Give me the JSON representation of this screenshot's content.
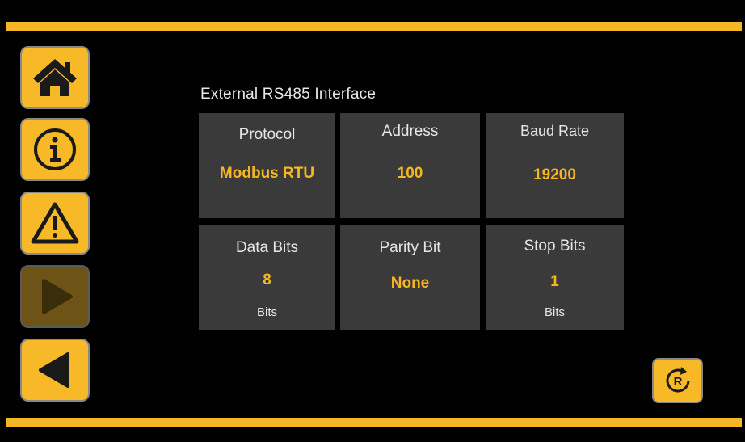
{
  "accent_color": "#f5b623",
  "page": {
    "title": "External RS485 Interface"
  },
  "nav": [
    {
      "icon": "home-icon"
    },
    {
      "icon": "info-icon"
    },
    {
      "icon": "warning-icon"
    },
    {
      "icon": "play-icon",
      "disabled": true
    },
    {
      "icon": "back-icon"
    }
  ],
  "settings": {
    "protocol": {
      "label": "Protocol",
      "value": "Modbus RTU"
    },
    "address": {
      "label": "Address",
      "value": "100"
    },
    "baud_rate": {
      "label": "Baud Rate",
      "value": "19200"
    },
    "data_bits": {
      "label": "Data Bits",
      "value": "8",
      "unit": "Bits"
    },
    "parity": {
      "label": "Parity Bit",
      "value": "None"
    },
    "stop_bits": {
      "label": "Stop Bits",
      "value": "1",
      "unit": "Bits"
    }
  },
  "reset": {
    "icon": "reset-icon",
    "glyph": "R"
  }
}
